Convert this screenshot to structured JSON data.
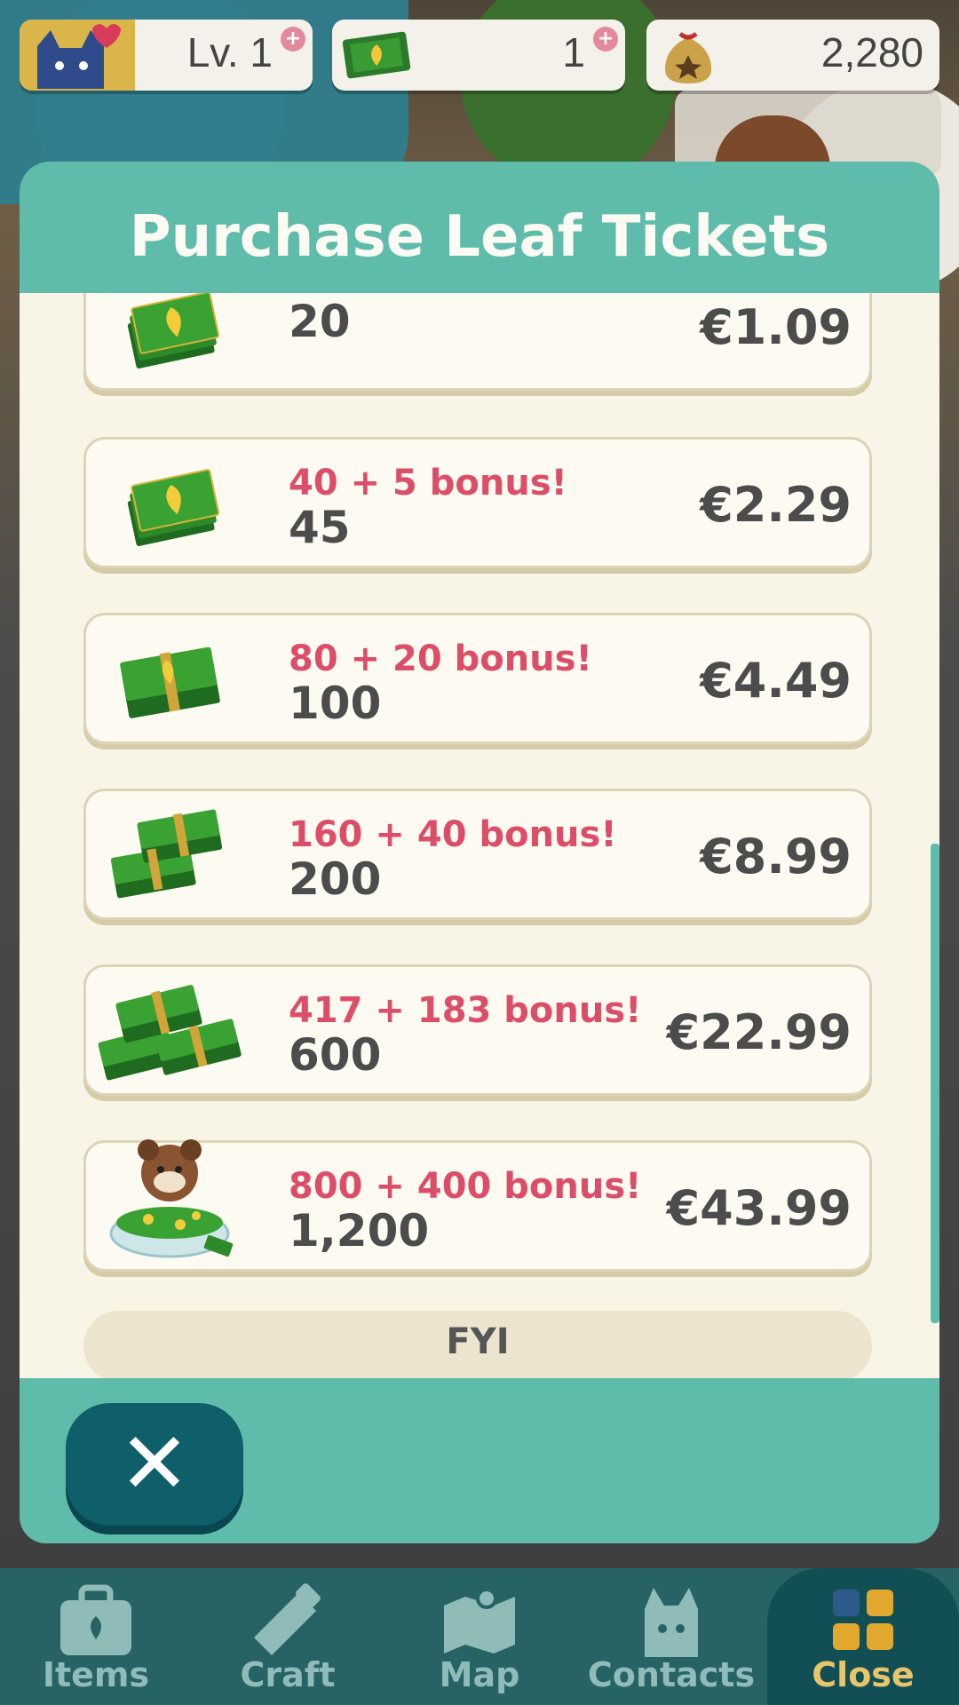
{
  "status_bar": {
    "level": "Lv. 1",
    "leaf_tickets": "1",
    "bells": "2,280"
  },
  "dialog": {
    "title": "Purchase Leaf Tickets",
    "offers": [
      {
        "bonus": "",
        "amount": "20",
        "price": "€1.09"
      },
      {
        "bonus": "40 + 5 bonus!",
        "amount": "45",
        "price": "€2.29"
      },
      {
        "bonus": "80 + 20 bonus!",
        "amount": "100",
        "price": "€4.49"
      },
      {
        "bonus": "160 + 40 bonus!",
        "amount": "200",
        "price": "€8.99"
      },
      {
        "bonus": "417 + 183 bonus!",
        "amount": "600",
        "price": "€22.99"
      },
      {
        "bonus": "800 + 400 bonus!",
        "amount": "1,200",
        "price": "€43.99"
      }
    ],
    "fyi_label": "FYI",
    "close_symbol": "✕"
  },
  "nav": {
    "items": [
      {
        "label": "Items",
        "icon": "bag-icon"
      },
      {
        "label": "Craft",
        "icon": "saw-icon"
      },
      {
        "label": "Map",
        "icon": "map-icon"
      },
      {
        "label": "Contacts",
        "icon": "cat-face-icon"
      },
      {
        "label": "Close",
        "icon": "grid-icon"
      }
    ]
  },
  "colors": {
    "teal": "#5fbcaa",
    "dark_teal": "#0f5f6b",
    "bonus_pink": "#dc4e68",
    "cream": "#f8f5e7"
  }
}
